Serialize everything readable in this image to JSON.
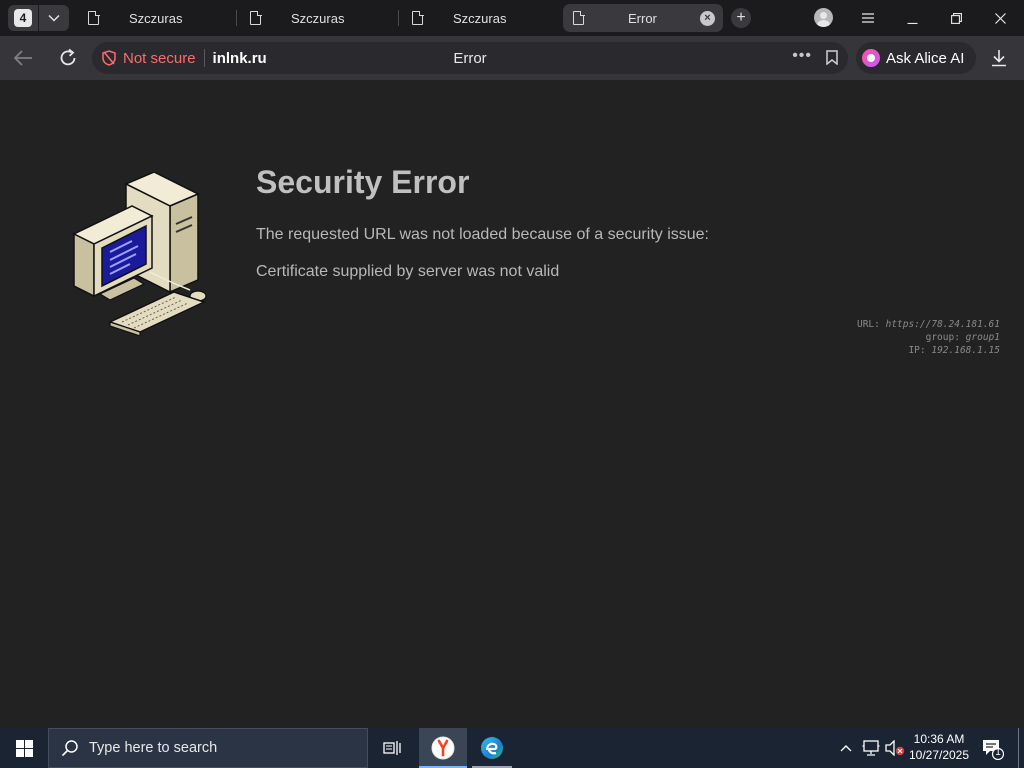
{
  "browser": {
    "tab_count": "4",
    "tabs": [
      {
        "title": "Szczuras",
        "active": false
      },
      {
        "title": "Szczuras",
        "active": false
      },
      {
        "title": "Szczuras",
        "active": false
      },
      {
        "title": "Error",
        "active": true
      }
    ],
    "new_tab_symbol": "+",
    "close_symbol": "×"
  },
  "address_bar": {
    "security_label": "Not secure",
    "domain": "inlnk.ru",
    "page_title": "Error",
    "more_symbol": "•••",
    "alice_label": "Ask Alice AI"
  },
  "error_page": {
    "title": "Security Error",
    "message": "The requested URL was not loaded because of a security issue:",
    "detail": "Certificate supplied by server was not valid",
    "diagnostics": [
      {
        "key": "URL:",
        "value": "https://78.24.181.61"
      },
      {
        "key": "group:",
        "value": "group1"
      },
      {
        "key": "IP:",
        "value": "192.168.1.15"
      }
    ]
  },
  "taskbar": {
    "search_placeholder": "Type here to search",
    "time": "10:36 AM",
    "date": "10/27/2025",
    "notification_count": "1"
  },
  "colors": {
    "accent_not_secure": "#ff6a6a",
    "page_background": "#222222",
    "taskbar_background": "#1a2433"
  }
}
